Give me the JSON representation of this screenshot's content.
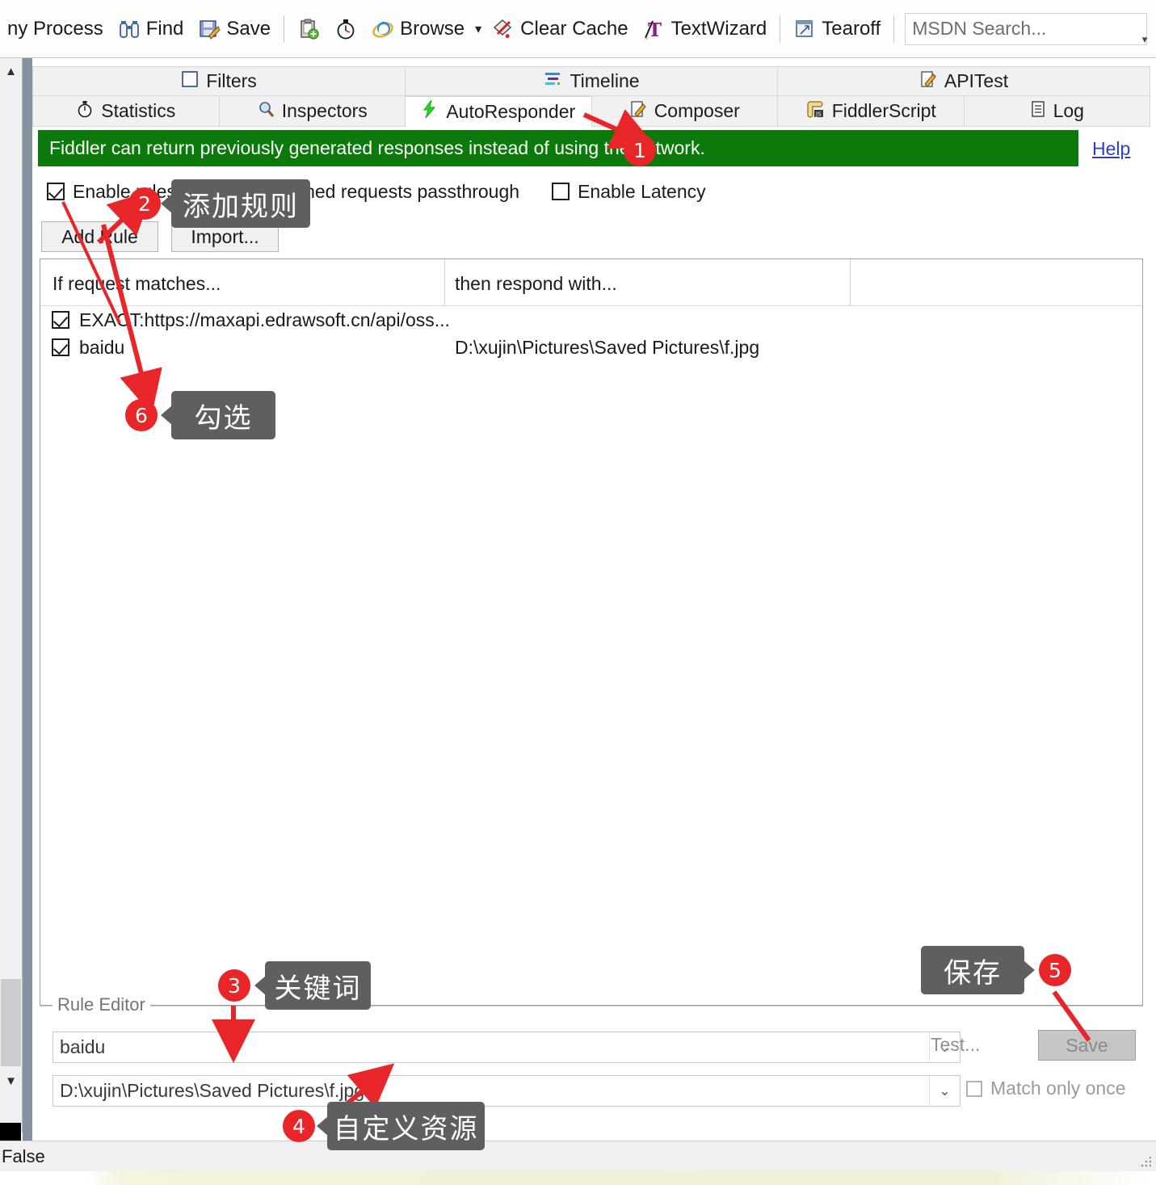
{
  "toolbar": {
    "items": [
      {
        "label": "ny Process",
        "icon": "process-icon",
        "has_icon": false
      },
      {
        "label": "Find",
        "icon": "find-binoculars-icon",
        "has_icon": true
      },
      {
        "label": "Save",
        "icon": "save-disk-icon",
        "has_icon": true
      },
      {
        "label": "",
        "icon": "clipboard-add-icon",
        "has_icon": true
      },
      {
        "label": "",
        "icon": "stopwatch-icon",
        "has_icon": true
      },
      {
        "label": "Browse",
        "icon": "internet-explorer-icon",
        "has_icon": true
      },
      {
        "label": "Clear Cache",
        "icon": "clear-cache-icon",
        "has_icon": true
      },
      {
        "label": "TextWizard",
        "icon": "text-wizard-icon",
        "has_icon": true
      },
      {
        "label": "Tearoff",
        "icon": "tearoff-window-icon",
        "has_icon": true
      }
    ],
    "search_placeholder": "MSDN Search...",
    "dropdown_caret": "▾",
    "overflow_glyph": "▾"
  },
  "tabs_top": [
    {
      "label": "Filters",
      "icon": "filter-checkbox-icon"
    },
    {
      "label": "Timeline",
      "icon": "timeline-icon"
    },
    {
      "label": "APITest",
      "icon": "pencil-icon"
    }
  ],
  "tabs_main": [
    {
      "label": "Statistics",
      "icon": "stopwatch-icon",
      "active": false
    },
    {
      "label": "Inspectors",
      "icon": "magnifier-icon",
      "active": false
    },
    {
      "label": "AutoResponder",
      "icon": "lightning-bolt-icon",
      "active": true
    },
    {
      "label": "Composer",
      "icon": "pencil-pad-icon",
      "active": false
    },
    {
      "label": "FiddlerScript",
      "icon": "js-scroll-icon",
      "active": false
    },
    {
      "label": "Log",
      "icon": "log-list-icon",
      "active": false
    }
  ],
  "banner": {
    "text": "Fiddler can return previously generated responses instead of using the network.",
    "help_label": "Help",
    "background": "#0b7a0b",
    "help_color": "#2b40c8"
  },
  "options": [
    {
      "label": "Enable rules",
      "checked": true
    },
    {
      "label": "Unmatched requests passthrough",
      "checked": false
    },
    {
      "label": "Enable Latency",
      "checked": false
    }
  ],
  "buttons": {
    "add_rule": "Add Rule",
    "import": "Import..."
  },
  "rules_table": {
    "columns": [
      "If request matches...",
      "then respond with..."
    ],
    "rows": [
      {
        "checked": true,
        "match": "EXACT:https://maxapi.edrawsoft.cn/api/oss...",
        "respond": ""
      },
      {
        "checked": true,
        "match": "baidu",
        "respond": "D:\\xujin\\Pictures\\Saved Pictures\\f.jpg"
      }
    ]
  },
  "rule_editor": {
    "legend": "Rule Editor",
    "match_value": "baidu",
    "response_value": "D:\\xujin\\Pictures\\Saved Pictures\\f.jpg",
    "test_label": "Test...",
    "save_label": "Save",
    "match_once_label": "Match only once",
    "match_once_checked": false,
    "dropdown_glyph": "⌄"
  },
  "statusbar": {
    "text": "False"
  },
  "annotations": {
    "marker_color": "#e8262a",
    "callout_bg": "#5f5f5f",
    "items": [
      {
        "number": "1",
        "label": ""
      },
      {
        "number": "2",
        "label": "添加规则"
      },
      {
        "number": "3",
        "label": "关键词"
      },
      {
        "number": "4",
        "label": "自定义资源"
      },
      {
        "number": "5",
        "label": "保存"
      },
      {
        "number": "6",
        "label": "勾选"
      }
    ]
  }
}
